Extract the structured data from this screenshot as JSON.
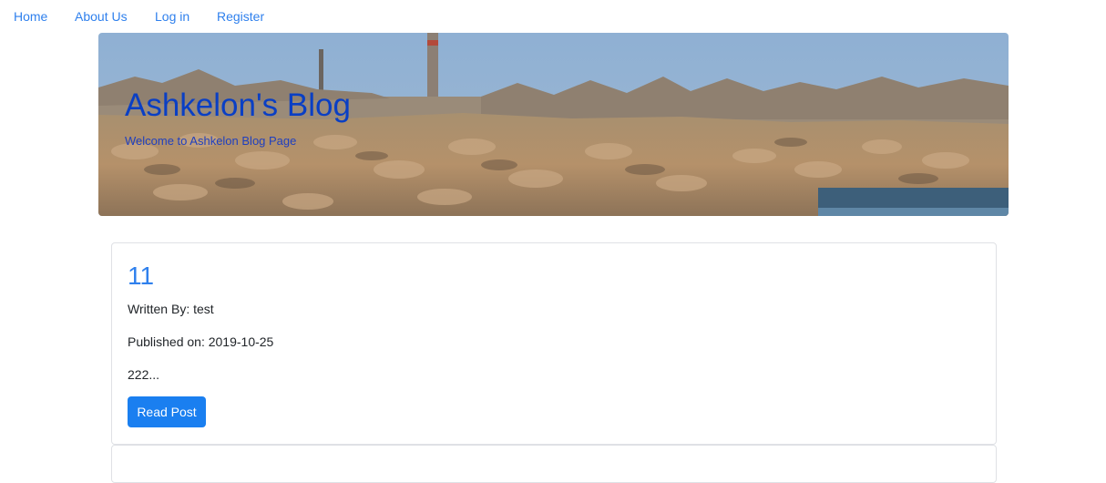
{
  "nav": {
    "home": "Home",
    "about": "About Us",
    "login": "Log in",
    "register": "Register"
  },
  "hero": {
    "title": "Ashkelon's Blog",
    "subtitle": "Welcome to Ashkelon Blog Page",
    "image": "harbor-breakwater-photo"
  },
  "posts": [
    {
      "title": "11",
      "author": "Written By: test",
      "published": "Published on: 2019-10-25",
      "excerpt": "222...",
      "button_label": "Read Post"
    }
  ],
  "colors": {
    "link": "#2f80ed",
    "button": "#1a7ff0",
    "hero_title": "#0a3fc4"
  }
}
